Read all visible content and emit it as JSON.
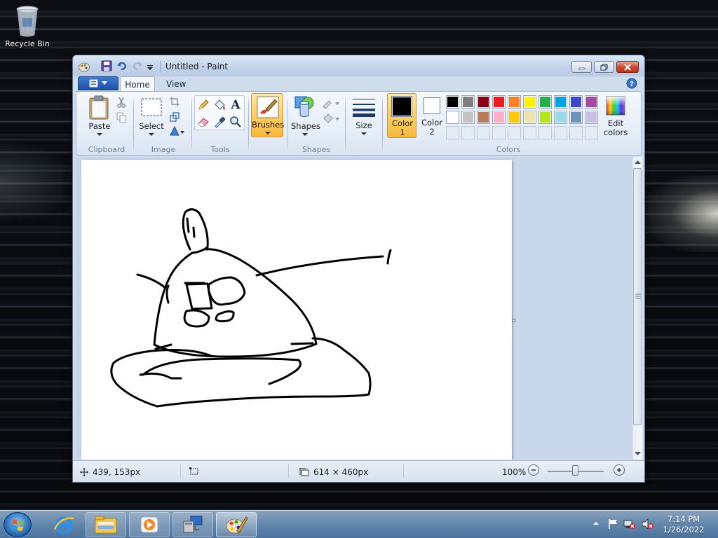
{
  "desktop": {
    "icons": [
      {
        "label": "Recycle Bin",
        "icon": "recycle-bin-icon"
      }
    ]
  },
  "window": {
    "title": "Untitled - Paint",
    "controls": {
      "minimize": "minimize-icon",
      "maximize": "maximize-icon",
      "close": "close-icon"
    }
  },
  "ribbon": {
    "tabs": [
      {
        "label": "Home",
        "selected": true
      },
      {
        "label": "View",
        "selected": false
      }
    ],
    "groups": {
      "clipboard": {
        "label": "Clipboard",
        "paste": "Paste"
      },
      "image": {
        "label": "Image",
        "select": "Select"
      },
      "tools": {
        "label": "Tools",
        "text_tool": "A"
      },
      "brushes": {
        "label": "Brushes"
      },
      "shapes": {
        "label": "Shapes",
        "shapes_button": "Shapes"
      },
      "size": {
        "label": "Size"
      },
      "colors": {
        "label": "Colors",
        "color1_label": "Color\n1",
        "color1_line1": "Color",
        "color1_line2": "1",
        "color2_line1": "Color",
        "color2_line2": "2",
        "color1_value": "#000000",
        "color2_value": "#ffffff",
        "edit_colors_line1": "Edit",
        "edit_colors_line2": "colors",
        "palette_row1": [
          "#000000",
          "#7f7f7f",
          "#880015",
          "#ed1c24",
          "#ff7f27",
          "#fff200",
          "#22b14c",
          "#00a2e8",
          "#3f48cc",
          "#a349a4"
        ],
        "palette_row2": [
          "#ffffff",
          "#c3c3c3",
          "#b97a57",
          "#ffaec9",
          "#ffc90e",
          "#efe4b0",
          "#b5e61d",
          "#99d9ea",
          "#7092be",
          "#c8bfe7"
        ],
        "palette_row3_empty": 10
      }
    }
  },
  "status": {
    "cursor_position": "439, 153px",
    "image_size": "614 × 460px",
    "zoom": "100%"
  },
  "taskbar": {
    "pinned": [
      "internet-explorer-icon",
      "windows-explorer-icon",
      "media-player-icon",
      "remote-desktop-icon",
      "paint-icon"
    ],
    "active_app": "paint-icon",
    "clock_time": "7:14 PM",
    "clock_date": "1/26/2022"
  }
}
